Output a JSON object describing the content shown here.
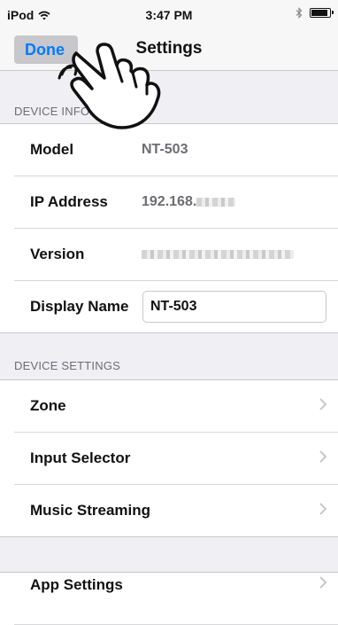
{
  "status_bar": {
    "carrier": "iPod",
    "time": "3:47 PM",
    "wifi_icon": "wifi-icon",
    "bluetooth_icon": "bluetooth-icon",
    "battery_icon": "battery-icon",
    "battery_level": 0.8
  },
  "nav": {
    "done_label": "Done",
    "title": "Settings"
  },
  "device_info": {
    "header": "DEVICE INFORMATION",
    "model": {
      "label": "Model",
      "value": "NT-503"
    },
    "ip": {
      "label": "IP Address",
      "value_prefix": "192.168."
    },
    "version": {
      "label": "Version"
    },
    "display_name": {
      "label": "Display Name",
      "value": "NT-503"
    }
  },
  "device_settings": {
    "header": "DEVICE SETTINGS",
    "items": [
      {
        "label": "Zone"
      },
      {
        "label": "Input Selector"
      },
      {
        "label": "Music Streaming"
      }
    ]
  },
  "app_settings": {
    "label": "App Settings"
  },
  "overlay": {
    "icon": "tap-hand-icon"
  }
}
